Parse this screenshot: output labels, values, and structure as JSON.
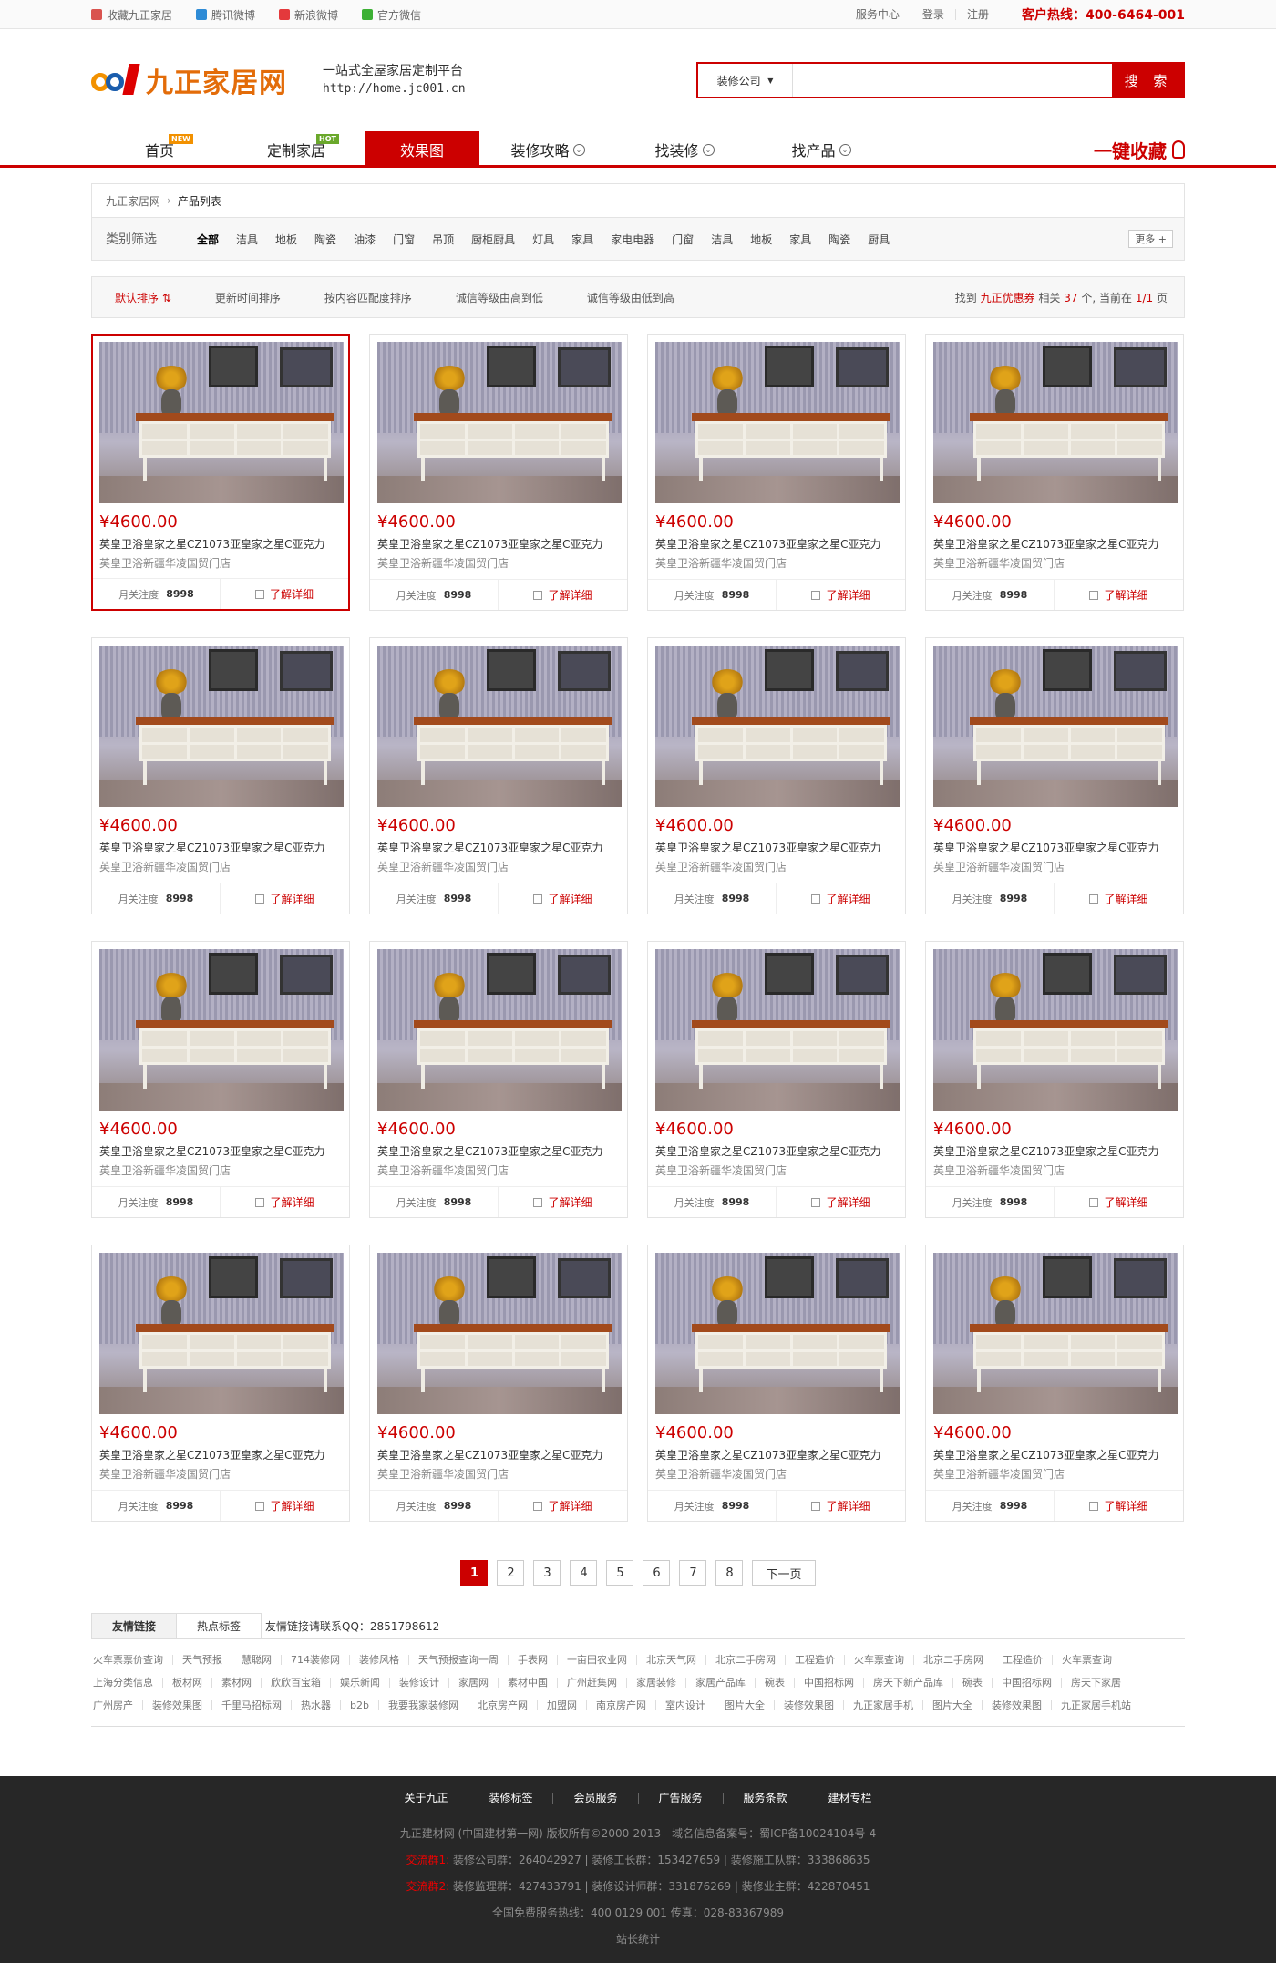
{
  "topbar": {
    "left": [
      {
        "label": "收藏九正家居",
        "icon": "heart-icon",
        "color": "#d9534f"
      },
      {
        "label": "腾讯微博",
        "icon": "tencent-weibo-icon",
        "color": "#2e8bd6"
      },
      {
        "label": "新浪微博",
        "icon": "sina-weibo-icon",
        "color": "#e4393c"
      },
      {
        "label": "官方微信",
        "icon": "wechat-icon",
        "color": "#3cb034"
      }
    ],
    "right": [
      "服务中心",
      "登录",
      "注册"
    ],
    "hotline": "客户热线：400-6464-001"
  },
  "header": {
    "logo_text": "九正家居网",
    "slogan": "一站式全屋家居定制平台",
    "url": "http://home.jc001.cn",
    "search": {
      "category": "装修公司",
      "placeholder": "",
      "button": "搜 索"
    }
  },
  "nav": {
    "items": [
      {
        "label": "首页",
        "badge": "NEW",
        "badge_color": "#f29100"
      },
      {
        "label": "定制家居",
        "badge": "HOT",
        "badge_color": "#6aa82b"
      },
      {
        "label": "效果图",
        "active": true
      },
      {
        "label": "装修攻略",
        "chevron": true
      },
      {
        "label": "找装修",
        "chevron": true
      },
      {
        "label": "找产品",
        "chevron": true
      }
    ],
    "favorite": "一键收藏"
  },
  "breadcrumb": [
    "九正家居网",
    "产品列表"
  ],
  "filter": {
    "label": "类别筛选",
    "items": [
      "全部",
      "洁具",
      "地板",
      "陶瓷",
      "油漆",
      "门窗",
      "吊顶",
      "厨柜厨具",
      "灯具",
      "家具",
      "家电电器",
      "门窗",
      "洁具",
      "地板",
      "家具",
      "陶瓷",
      "厨具"
    ],
    "more": "更多 +"
  },
  "sort": {
    "options": [
      "默认排序 ⇅",
      "更新时间排序",
      "按内容匹配度排序",
      "诚信等级由高到低",
      "诚信等级由低到高"
    ],
    "result": {
      "prefix": "找到",
      "keyword": "九正优惠券",
      "mid": "相关",
      "count": "37",
      "unit": "个, 当前在",
      "page": "1/1",
      "suffix": "页"
    }
  },
  "products": [
    {
      "price": "¥4600.00",
      "name": "英皇卫浴皇家之星CZ1073亚皇家之星C亚克力",
      "shop": "英皇卫浴新疆华凌国贸门店",
      "attention_label": "月关注度",
      "attention": "8998",
      "detail": "了解详细"
    }
  ],
  "pagination": {
    "pages": [
      "1",
      "2",
      "3",
      "4",
      "5",
      "6",
      "7",
      "8"
    ],
    "current": "1",
    "next": "下一页"
  },
  "links": {
    "tabs": [
      "友情链接",
      "热点标签"
    ],
    "contact": "友情链接请联系QQ：2851798612",
    "rows": [
      [
        "火车票票价查询",
        "天气预报",
        "慧聪网",
        "714装修网",
        "装修风格",
        "天气预报查询一周",
        "手表网",
        "一亩田农业网",
        "北京天气网",
        "北京二手房网",
        "工程造价",
        "火车票查询",
        "北京二手房网",
        "工程造价",
        "火车票查询"
      ],
      [
        "上海分类信息",
        "板材网",
        "素材网",
        "欣欣百宝箱",
        "娱乐新闻",
        "装修设计",
        "家居网",
        "素材中国",
        "广州赶集网",
        "家居装修",
        "家居产品库",
        "碗表",
        "中国招标网",
        "房天下新产品库",
        "碗表",
        "中国招标网",
        "房天下家居"
      ],
      [
        "广州房产",
        "装修效果图",
        "千里马招标网",
        "热水器",
        "b2b",
        "我要我家装修网",
        "北京房产网",
        "加盟网",
        "南京房产网",
        "室内设计",
        "图片大全",
        "装修效果图",
        "九正家居手机",
        "图片大全",
        "装修效果图",
        "九正家居手机站"
      ]
    ]
  },
  "footer": {
    "nav": [
      "关于九正",
      "装修标签",
      "会员服务",
      "广告服务",
      "服务条款",
      "建材专栏"
    ],
    "copyright": "九正建材网 (中国建材第一网) 版权所有©2000-2013　域名信息备案号：蜀ICP备10024104号-4",
    "group1_label": "交流群1:",
    "group1": "装修公司群：264042927 | 装修工长群：153427659 | 装修施工队群：333868635",
    "group2_label": "交流群2:",
    "group2": "装修监理群：427433791 | 装修设计师群：331876269 | 装修业主群：422870451",
    "service": "全国免费服务热线：400 0129 001 传真：028-83367989",
    "stats": "站长统计"
  }
}
